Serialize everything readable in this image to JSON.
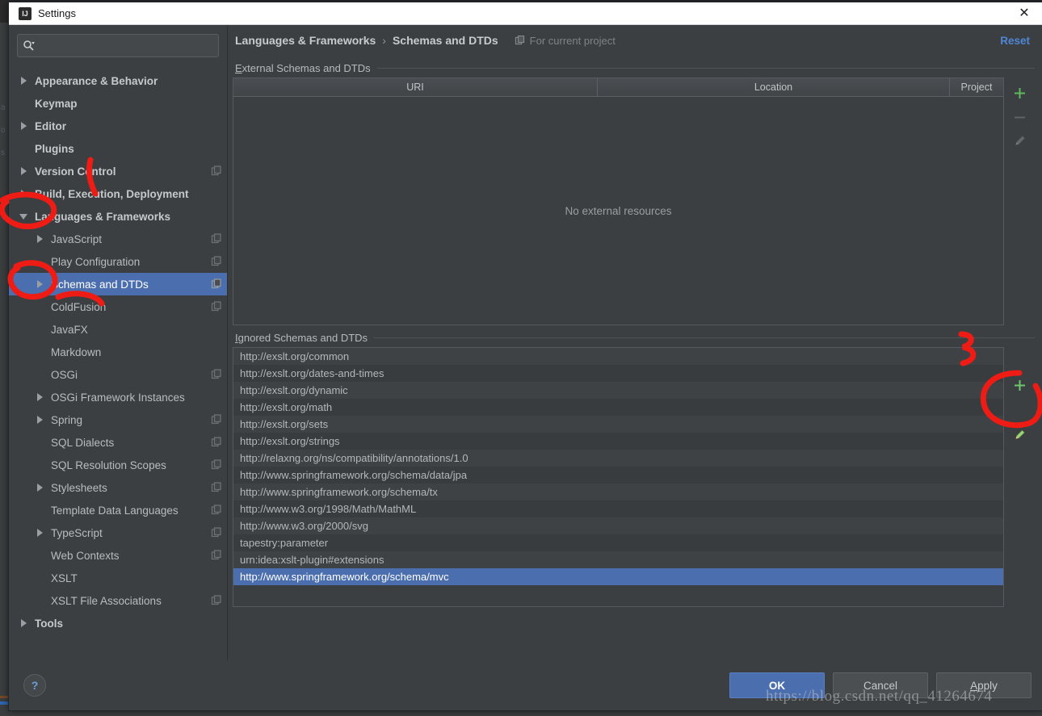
{
  "window": {
    "title": "Settings",
    "app_icon": "intellij-idea-icon",
    "close_label": "✕"
  },
  "search": {
    "value": "",
    "placeholder": "",
    "icon": "search-icon"
  },
  "sidebar": {
    "items": [
      {
        "label": "Appearance & Behavior",
        "level": 0,
        "twisty": "closed",
        "badge": false,
        "selected": false
      },
      {
        "label": "Keymap",
        "level": 0,
        "twisty": "none",
        "badge": false,
        "selected": false
      },
      {
        "label": "Editor",
        "level": 0,
        "twisty": "closed",
        "badge": false,
        "selected": false
      },
      {
        "label": "Plugins",
        "level": 0,
        "twisty": "none",
        "badge": false,
        "selected": false
      },
      {
        "label": "Version Control",
        "level": 0,
        "twisty": "closed",
        "badge": true,
        "selected": false
      },
      {
        "label": "Build, Execution, Deployment",
        "level": 0,
        "twisty": "closed",
        "badge": false,
        "selected": false
      },
      {
        "label": "Languages & Frameworks",
        "level": 0,
        "twisty": "open",
        "badge": false,
        "selected": false
      },
      {
        "label": "JavaScript",
        "level": 1,
        "twisty": "closed",
        "badge": true,
        "selected": false
      },
      {
        "label": "Play Configuration",
        "level": 1,
        "twisty": "none",
        "badge": true,
        "selected": false
      },
      {
        "label": "Schemas and DTDs",
        "level": 1,
        "twisty": "closed",
        "badge": true,
        "selected": true
      },
      {
        "label": "ColdFusion",
        "level": 1,
        "twisty": "none",
        "badge": true,
        "selected": false
      },
      {
        "label": "JavaFX",
        "level": 1,
        "twisty": "none",
        "badge": false,
        "selected": false
      },
      {
        "label": "Markdown",
        "level": 1,
        "twisty": "none",
        "badge": false,
        "selected": false
      },
      {
        "label": "OSGi",
        "level": 1,
        "twisty": "none",
        "badge": true,
        "selected": false
      },
      {
        "label": "OSGi Framework Instances",
        "level": 1,
        "twisty": "closed",
        "badge": false,
        "selected": false
      },
      {
        "label": "Spring",
        "level": 1,
        "twisty": "closed",
        "badge": true,
        "selected": false
      },
      {
        "label": "SQL Dialects",
        "level": 1,
        "twisty": "none",
        "badge": true,
        "selected": false
      },
      {
        "label": "SQL Resolution Scopes",
        "level": 1,
        "twisty": "none",
        "badge": true,
        "selected": false
      },
      {
        "label": "Stylesheets",
        "level": 1,
        "twisty": "closed",
        "badge": true,
        "selected": false
      },
      {
        "label": "Template Data Languages",
        "level": 1,
        "twisty": "none",
        "badge": true,
        "selected": false
      },
      {
        "label": "TypeScript",
        "level": 1,
        "twisty": "closed",
        "badge": true,
        "selected": false
      },
      {
        "label": "Web Contexts",
        "level": 1,
        "twisty": "none",
        "badge": true,
        "selected": false
      },
      {
        "label": "XSLT",
        "level": 1,
        "twisty": "none",
        "badge": false,
        "selected": false
      },
      {
        "label": "XSLT File Associations",
        "level": 1,
        "twisty": "none",
        "badge": true,
        "selected": false
      },
      {
        "label": "Tools",
        "level": 0,
        "twisty": "closed",
        "badge": false,
        "selected": false
      }
    ]
  },
  "breadcrumb": {
    "parent": "Languages & Frameworks",
    "separator": "›",
    "current": "Schemas and DTDs",
    "scope_label": "For current project",
    "scope_icon": "project-scope-icon",
    "reset_label": "Reset"
  },
  "external": {
    "section_title": "External Schemas and DTDs",
    "section_title_mnemonic": "E",
    "columns": [
      "URI",
      "Location",
      "Project"
    ],
    "rows": [],
    "empty_text": "No external resources",
    "tools": [
      {
        "name": "add-external-button",
        "icon": "plus-icon",
        "color": "#5fb85f",
        "enabled": true
      },
      {
        "name": "remove-external-button",
        "icon": "minus-icon",
        "color": "#8a8d90",
        "enabled": false
      },
      {
        "name": "edit-external-button",
        "icon": "pencil-icon",
        "color": "#8a8d90",
        "enabled": false
      }
    ]
  },
  "ignored": {
    "section_title": "Ignored Schemas and DTDs",
    "section_title_mnemonic": "I",
    "selected_index": 13,
    "rows": [
      "http://exslt.org/common",
      "http://exslt.org/dates-and-times",
      "http://exslt.org/dynamic",
      "http://exslt.org/math",
      "http://exslt.org/sets",
      "http://exslt.org/strings",
      "http://relaxng.org/ns/compatibility/annotations/1.0",
      "http://www.springframework.org/schema/data/jpa",
      "http://www.springframework.org/schema/tx",
      "http://www.w3.org/1998/Math/MathML",
      "http://www.w3.org/2000/svg",
      "tapestry:parameter",
      "urn:idea:xslt-plugin#extensions",
      "http://www.springframework.org/schema/mvc"
    ],
    "tools": [
      {
        "name": "add-ignored-button",
        "icon": "plus-icon",
        "color": "#6fc46f",
        "enabled": true
      },
      {
        "name": "edit-ignored-button",
        "icon": "pencil-icon",
        "color": "#8fd36a",
        "enabled": true
      }
    ]
  },
  "footer": {
    "help_label": "?",
    "ok_label": "OK",
    "cancel_label": "Cancel",
    "apply_label": "Apply",
    "apply_mnemonic": "A"
  },
  "watermark": {
    "text": "https://blog.csdn.net/qq_41264674"
  },
  "background": {
    "left_gutter_chars": [
      "a",
      "o",
      "s"
    ]
  },
  "colors": {
    "selection": "#4b6eaf",
    "accent_link": "#4f86d6",
    "panel": "#3c3f41",
    "annotation": "#ee1c15",
    "green_icon": "#5fb85f"
  }
}
